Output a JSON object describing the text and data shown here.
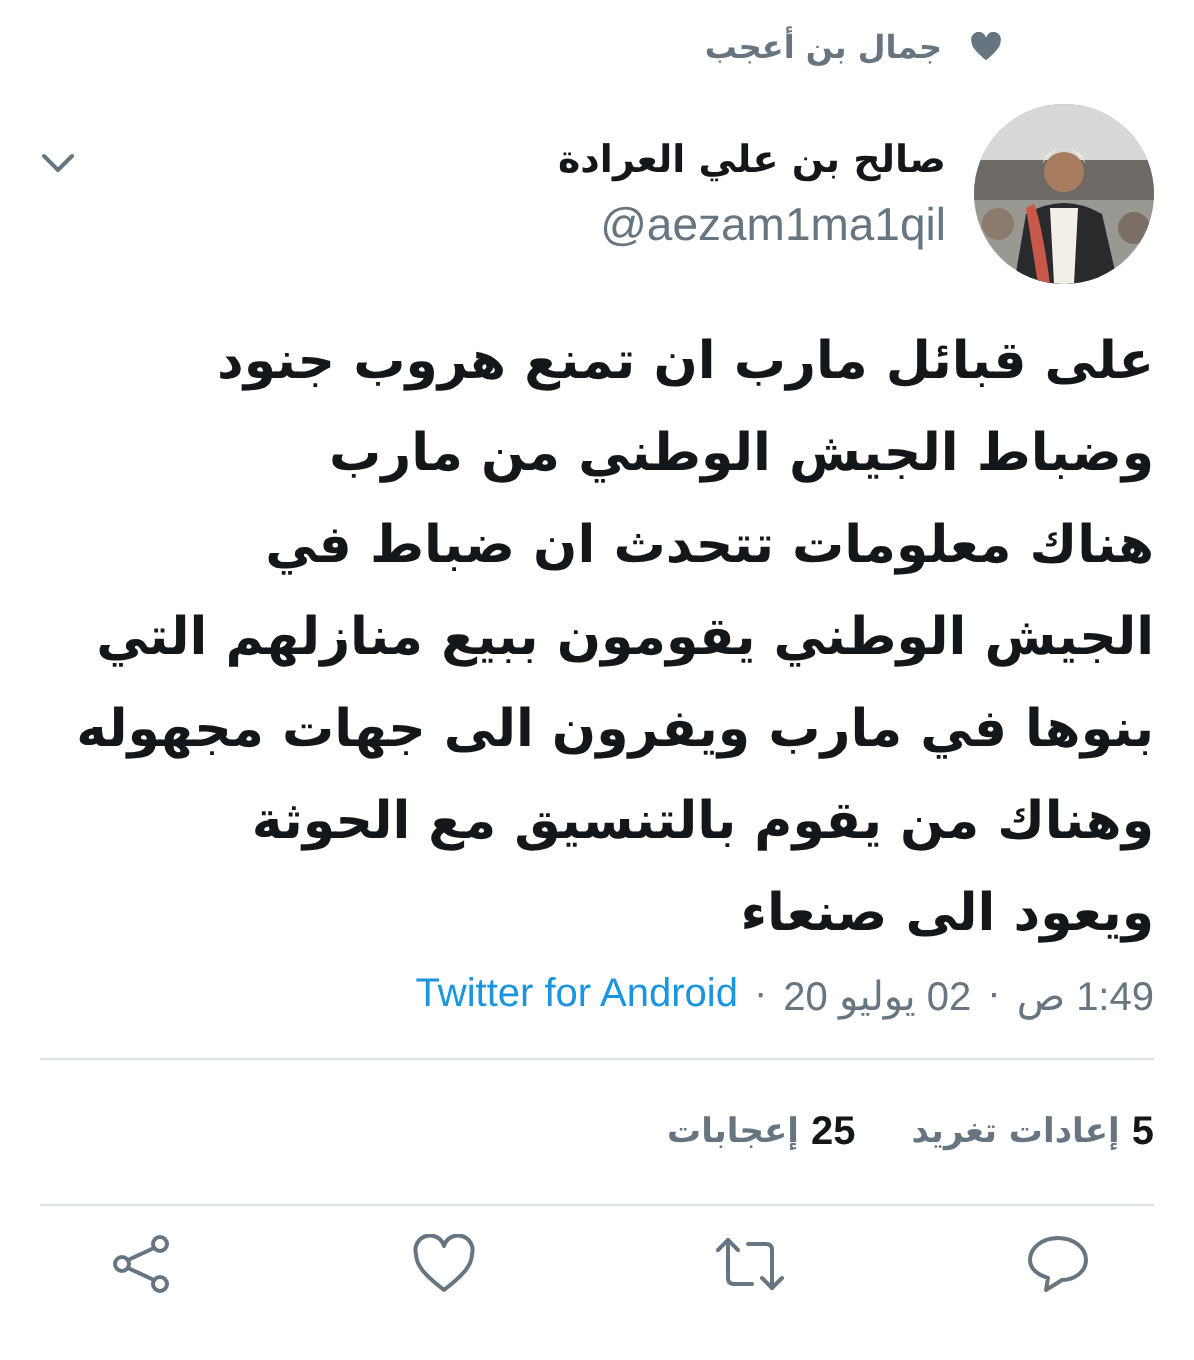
{
  "liked_by": {
    "name": "جمال بن أعجب"
  },
  "author": {
    "name": "صالح بن علي العرادة",
    "handle": "@aezam1ma1qil"
  },
  "tweet": {
    "lines": [
      "على قبائل مارب ان تمنع هروب جنود",
      "وضباط الجيش الوطني من مارب",
      "هناك معلومات تتحدث ان ضباط في",
      "الجيش الوطني يقومون ببيع منازلهم التي",
      "بنوها في مارب ويفرون الى جهات مجهوله",
      "وهناك من يقوم بالتنسيق مع الحوثة",
      "ويعود الى صنعاء"
    ]
  },
  "meta": {
    "time": "1:49 ص",
    "date": "02 يوليو 20",
    "separator": "·",
    "source": "Twitter for Android"
  },
  "stats": [
    {
      "count": "5",
      "label": "إعادات تغريد"
    },
    {
      "count": "25",
      "label": "إعجابات"
    }
  ]
}
